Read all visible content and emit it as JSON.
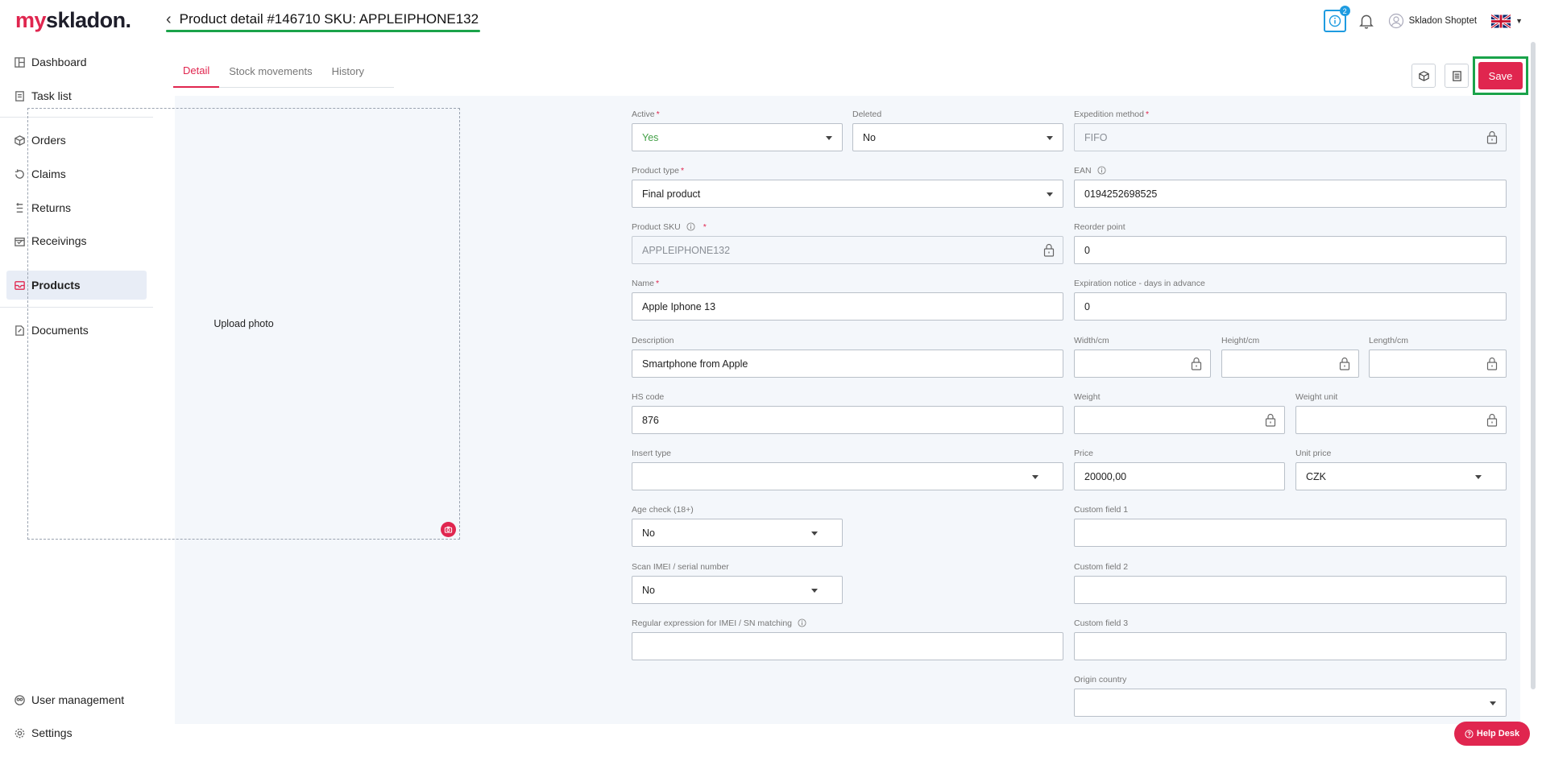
{
  "brand": {
    "logo_prefix": "my",
    "logo_suffix": "skladon."
  },
  "sidebar": {
    "items": [
      {
        "label": "Dashboard"
      },
      {
        "label": "Task list"
      },
      {
        "label": "Orders"
      },
      {
        "label": "Claims"
      },
      {
        "label": "Returns"
      },
      {
        "label": "Receivings"
      },
      {
        "label": "Products"
      },
      {
        "label": "Documents"
      }
    ],
    "bottom": [
      {
        "label": "User management"
      },
      {
        "label": "Settings"
      }
    ]
  },
  "header": {
    "title": "Product detail #146710 SKU: APPLEIPHONE132",
    "notification_count": "2",
    "user_name": "Skladon Shoptet"
  },
  "tabs": [
    {
      "label": "Detail"
    },
    {
      "label": "Stock movements"
    },
    {
      "label": "History"
    }
  ],
  "toolbar": {
    "save_label": "Save"
  },
  "upload": {
    "label": "Upload photo"
  },
  "form": {
    "active": {
      "label": "Active",
      "value": "Yes"
    },
    "deleted": {
      "label": "Deleted",
      "value": "No"
    },
    "expedition_method": {
      "label": "Expedition method",
      "value": "FIFO"
    },
    "product_type": {
      "label": "Product type",
      "value": "Final product"
    },
    "ean": {
      "label": "EAN",
      "value": "0194252698525"
    },
    "product_sku": {
      "label": "Product SKU",
      "value": "APPLEIPHONE132"
    },
    "reorder_point": {
      "label": "Reorder point",
      "value": "0"
    },
    "name": {
      "label": "Name",
      "value": "Apple Iphone 13"
    },
    "expiration_notice": {
      "label": "Expiration notice - days in advance",
      "value": "0"
    },
    "description": {
      "label": "Description",
      "value": "Smartphone from Apple"
    },
    "width": {
      "label": "Width/cm",
      "value": ""
    },
    "height": {
      "label": "Height/cm",
      "value": ""
    },
    "length": {
      "label": "Length/cm",
      "value": ""
    },
    "hs_code": {
      "label": "HS code",
      "value": "876"
    },
    "weight": {
      "label": "Weight",
      "value": ""
    },
    "weight_unit": {
      "label": "Weight unit",
      "value": ""
    },
    "insert_type": {
      "label": "Insert type",
      "value": ""
    },
    "price": {
      "label": "Price",
      "value": "20000,00"
    },
    "unit_price": {
      "label": "Unit price",
      "value": "CZK"
    },
    "age_check": {
      "label": "Age check (18+)",
      "value": "No"
    },
    "custom_field_1": {
      "label": "Custom field 1",
      "value": ""
    },
    "scan_imei": {
      "label": "Scan IMEI / serial number",
      "value": "No"
    },
    "custom_field_2": {
      "label": "Custom field 2",
      "value": ""
    },
    "regex_imei": {
      "label": "Regular expression for IMEI / SN matching",
      "value": ""
    },
    "custom_field_3": {
      "label": "Custom field 3",
      "value": ""
    },
    "origin_country": {
      "label": "Origin country",
      "value": ""
    }
  },
  "helpdesk": {
    "label": "Help Desk"
  },
  "colors": {
    "accent": "#e0264f",
    "highlight": "#1aa34a",
    "info": "#1e9be0"
  }
}
